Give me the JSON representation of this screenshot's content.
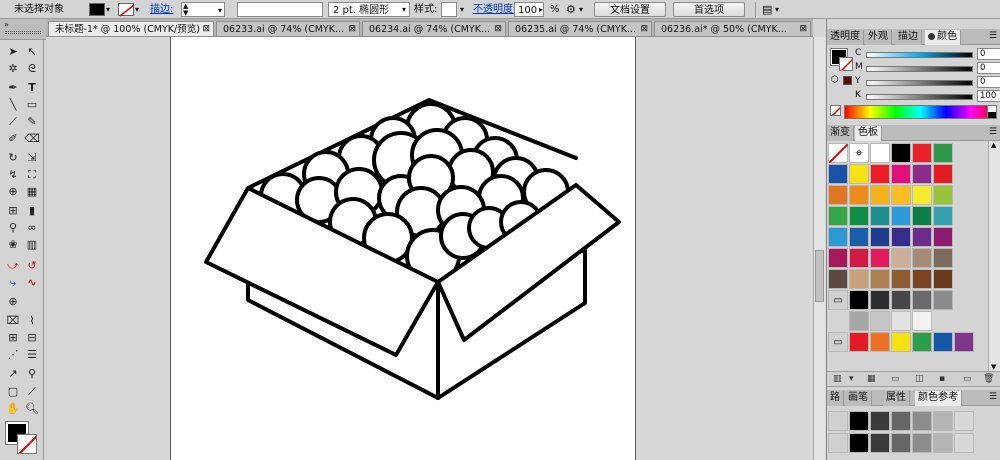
{
  "control_bar": {
    "selection_status": "未选择对象",
    "stroke_label": "描边:",
    "stroke_style": "2 pt. 椭圆形",
    "style_label": "样式:",
    "opacity_label": "不透明度:",
    "opacity_value": "100",
    "opacity_unit": "%",
    "doc_setup_button": "文档设置",
    "preferences_button": "首选项"
  },
  "document_tabs": [
    {
      "label": "未标题-1* @ 100% (CMYK/预览)",
      "active": true
    },
    {
      "label": "06233.ai @ 74% (CMYK...",
      "active": false
    },
    {
      "label": "06234.ai @ 74% (CMYK...",
      "active": false
    },
    {
      "label": "06235.ai @ 74% (CMYK...",
      "active": false
    },
    {
      "label": "06236.ai* @ 50% (CMYK...",
      "active": false
    }
  ],
  "panels": {
    "top_tabs": [
      "透明度",
      "外观",
      "描边",
      "颜色"
    ],
    "color": {
      "channels": [
        {
          "label": "C",
          "value": "0"
        },
        {
          "label": "M",
          "value": "0"
        },
        {
          "label": "Y",
          "value": "0"
        },
        {
          "label": "K",
          "value": "100"
        }
      ]
    },
    "swatch_tabs": [
      "渐变",
      "色板"
    ],
    "bottom_tabs": [
      "路",
      "画笔",
      "属性",
      "颜色参考"
    ],
    "swatch_colors": [
      "#e8202a",
      "#2c9a4a",
      "#1a52a8",
      "#f7e311",
      "#ee1c25",
      "#e00f7b",
      "#8c2c8a",
      "#e31c23",
      "#e27425",
      "#ee8c1b",
      "#f4b21a",
      "#fabd22",
      "#f4ec2c",
      "#97c43c",
      "#33a748",
      "#0f8e47",
      "#1c8f8f",
      "#2c9bd6",
      "#0a7f4a",
      "#36a0ad",
      "#2c99d3",
      "#1c5fa8",
      "#1f3c8e",
      "#3a2c8a",
      "#6c2c8c",
      "#8c1c72",
      "#a71a5a",
      "#d31a47",
      "#e21b5f",
      "#ccb09a",
      "#a58b75",
      "#7b6a5d",
      "#5a4a43",
      "#c9a27c",
      "#ae7e50",
      "#8e5c32",
      "#7a4422",
      "#6a3a1c",
      "#542c16",
      "#3ea8d8",
      "#1e3c8c",
      "#e8198a"
    ],
    "gray_swatches": [
      "#000000",
      "#2e2e2e",
      "#474747",
      "#6a6a6a",
      "#8a8a8a",
      "#a6a6a6",
      "#c6c6c6",
      "#e2e2e2",
      "#f2f2f2"
    ],
    "bright_swatches": [
      "#e31c23",
      "#ee7123",
      "#f7e211",
      "#2e9d49",
      "#1459a8",
      "#80358c"
    ]
  }
}
